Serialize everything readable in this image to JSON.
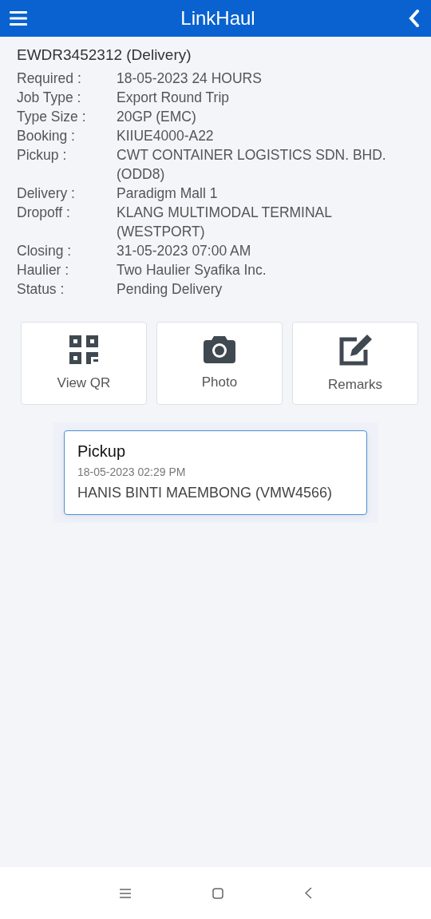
{
  "header": {
    "title": "LinkHaul"
  },
  "job": {
    "title": "EWDR3452312 (Delivery)",
    "fields": [
      {
        "label": "Required :",
        "value": "18-05-2023 24 HOURS"
      },
      {
        "label": "Job Type :",
        "value": "Export Round Trip"
      },
      {
        "label": "Type Size :",
        "value": "20GP (EMC)"
      },
      {
        "label": "Booking :",
        "value": "KIIUE4000-A22"
      },
      {
        "label": "Pickup :",
        "value": "CWT CONTAINER LOGISTICS SDN. BHD. (ODD8)"
      },
      {
        "label": "Delivery :",
        "value": "Paradigm Mall 1"
      },
      {
        "label": "Dropoff :",
        "value": "KLANG MULTIMODAL TERMINAL (WESTPORT)"
      },
      {
        "label": "Closing :",
        "value": "31-05-2023 07:00 AM"
      },
      {
        "label": "Haulier :",
        "value": "Two Haulier Syafika Inc."
      },
      {
        "label": "Status :",
        "value": "Pending Delivery"
      }
    ]
  },
  "actions": [
    {
      "kind": "qr",
      "label": "View QR"
    },
    {
      "kind": "camera",
      "label": "Photo"
    },
    {
      "kind": "edit",
      "label": "Remarks"
    }
  ],
  "history": [
    {
      "title": "Pickup",
      "time": "18-05-2023 02:29 PM",
      "detail": "HANIS BINTI MAEMBONG (VMW4566)"
    }
  ]
}
